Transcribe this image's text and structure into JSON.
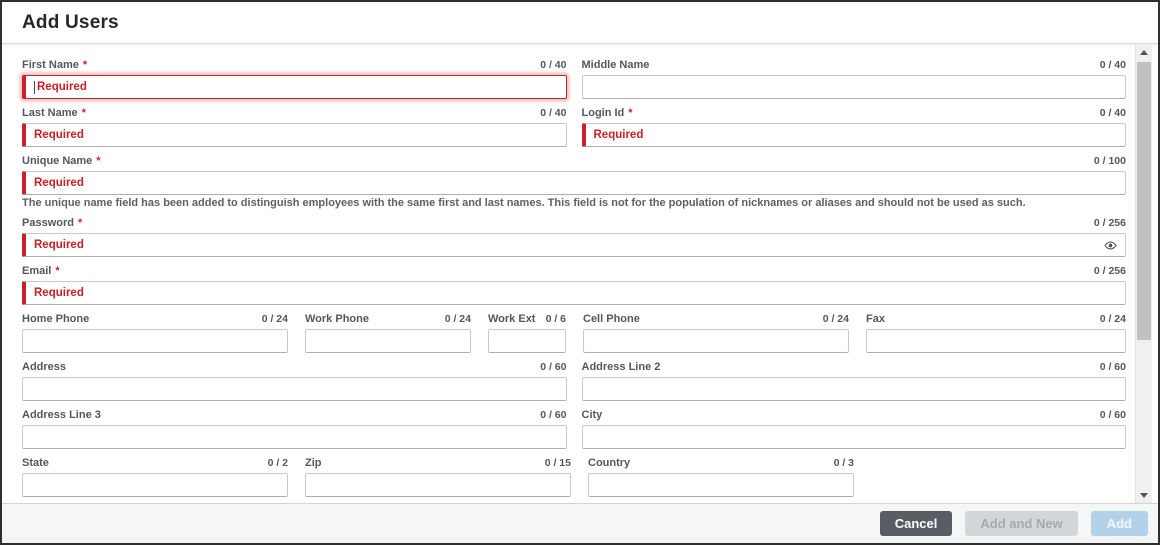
{
  "header": {
    "title": "Add Users"
  },
  "required_marker": "*",
  "helper_text": "The unique name field has been added to distinguish employees with the same first and last names. This field is not for the population of nicknames or aliases and should not be used as such.",
  "fields": {
    "first_name": {
      "label": "First Name",
      "counter": "0 / 40",
      "placeholder": "Required",
      "required": true,
      "focused": true
    },
    "middle_name": {
      "label": "Middle Name",
      "counter": "0 / 40"
    },
    "last_name": {
      "label": "Last Name",
      "counter": "0 / 40",
      "placeholder": "Required",
      "required": true
    },
    "login_id": {
      "label": "Login Id",
      "counter": "0 / 40",
      "placeholder": "Required",
      "required": true
    },
    "unique_name": {
      "label": "Unique Name",
      "counter": "0 / 100",
      "placeholder": "Required",
      "required": true
    },
    "password": {
      "label": "Password",
      "counter": "0 / 256",
      "placeholder": "Required",
      "required": true
    },
    "email": {
      "label": "Email",
      "counter": "0 / 256",
      "placeholder": "Required",
      "required": true
    },
    "home_phone": {
      "label": "Home Phone",
      "counter": "0 / 24"
    },
    "work_phone": {
      "label": "Work Phone",
      "counter": "0 / 24"
    },
    "work_ext": {
      "label": "Work Ext",
      "counter": "0 / 6"
    },
    "cell_phone": {
      "label": "Cell Phone",
      "counter": "0 / 24"
    },
    "fax": {
      "label": "Fax",
      "counter": "0 / 24"
    },
    "address": {
      "label": "Address",
      "counter": "0 / 60"
    },
    "address_line_2": {
      "label": "Address Line 2",
      "counter": "0 / 60"
    },
    "address_line_3": {
      "label": "Address Line 3",
      "counter": "0 / 60"
    },
    "city": {
      "label": "City",
      "counter": "0 / 60"
    },
    "state": {
      "label": "State",
      "counter": "0 / 2"
    },
    "zip": {
      "label": "Zip",
      "counter": "0 / 15"
    },
    "country": {
      "label": "Country",
      "counter": "0 / 3"
    }
  },
  "icons": {
    "password_eye": "show-password-eye",
    "scroll_up": "scroll-up-arrow",
    "scroll_down": "scroll-down-arrow"
  },
  "footer": {
    "cancel_label": "Cancel",
    "add_and_new_label": "Add and New",
    "add_label": "Add"
  },
  "colors": {
    "accent_red": "#cb2026",
    "cancel_button_bg": "#575d63",
    "disabled_button_bg": "#d3d7da",
    "add_button_bg": "#b3d2e9"
  }
}
